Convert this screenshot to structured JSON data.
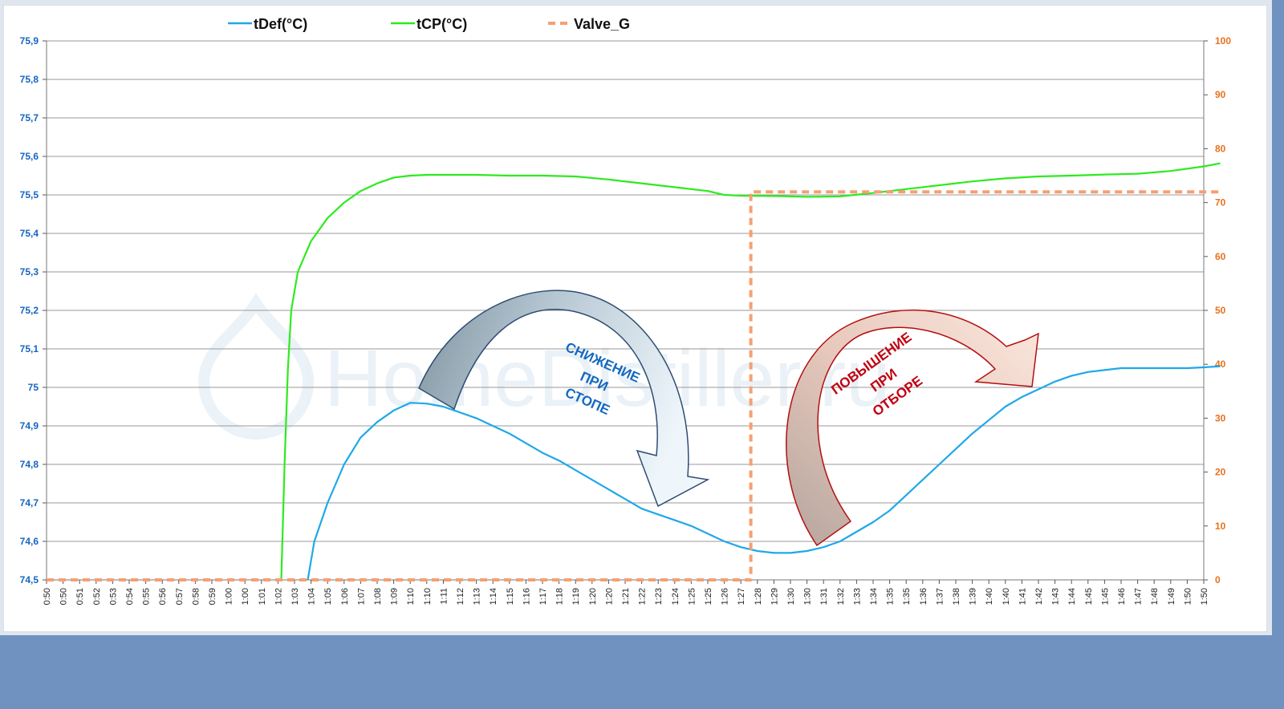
{
  "chart_data": {
    "type": "line",
    "legend_position": "top",
    "grid": true,
    "x_ticks": [
      "0:50",
      "0:50",
      "0:51",
      "0:52",
      "0:53",
      "0:54",
      "0:55",
      "0:56",
      "0:57",
      "0:58",
      "0:59",
      "1:00",
      "1:00",
      "1:01",
      "1:02",
      "1:03",
      "1:04",
      "1:05",
      "1:06",
      "1:07",
      "1:08",
      "1:09",
      "1:10",
      "1:10",
      "1:11",
      "1:12",
      "1:13",
      "1:14",
      "1:15",
      "1:16",
      "1:17",
      "1:18",
      "1:19",
      "1:20",
      "1:20",
      "1:21",
      "1:22",
      "1:23",
      "1:24",
      "1:25",
      "1:25",
      "1:26",
      "1:27",
      "1:28",
      "1:29",
      "1:30",
      "1:30",
      "1:31",
      "1:32",
      "1:33",
      "1:34",
      "1:35",
      "1:35",
      "1:36",
      "1:37",
      "1:38",
      "1:39",
      "1:40",
      "1:40",
      "1:41",
      "1:42",
      "1:43",
      "1:44",
      "1:45",
      "1:45",
      "1:46",
      "1:47",
      "1:48",
      "1:49",
      "1:50",
      "1:50"
    ],
    "y_left": {
      "min": 74.5,
      "max": 75.9,
      "step": 0.1,
      "tick_labels": [
        "74,5",
        "74,6",
        "74,7",
        "74,8",
        "74,9",
        "75",
        "75,1",
        "75,2",
        "75,3",
        "75,4",
        "75,5",
        "75,6",
        "75,7",
        "75,8",
        "75,9"
      ]
    },
    "y_right": {
      "min": 0,
      "max": 100,
      "step": 10,
      "tick_labels": [
        "0",
        "10",
        "20",
        "30",
        "40",
        "50",
        "60",
        "70",
        "80",
        "90",
        "100"
      ]
    },
    "series": [
      {
        "name": "tDef(°C)",
        "axis": "left",
        "color": "#1fa8e8",
        "dash": false,
        "points": [
          [
            15.8,
            74.5
          ],
          [
            16.2,
            74.6
          ],
          [
            17,
            74.7
          ],
          [
            18,
            74.8
          ],
          [
            19,
            74.87
          ],
          [
            20,
            74.91
          ],
          [
            21,
            74.94
          ],
          [
            22,
            74.96
          ],
          [
            23,
            74.958
          ],
          [
            24,
            74.95
          ],
          [
            25,
            74.935
          ],
          [
            26,
            74.92
          ],
          [
            27,
            74.9
          ],
          [
            28,
            74.88
          ],
          [
            29,
            74.855
          ],
          [
            30,
            74.83
          ],
          [
            31,
            74.81
          ],
          [
            32,
            74.785
          ],
          [
            33,
            74.76
          ],
          [
            34,
            74.735
          ],
          [
            35,
            74.71
          ],
          [
            36,
            74.685
          ],
          [
            37,
            74.67
          ],
          [
            38,
            74.655
          ],
          [
            39,
            74.64
          ],
          [
            40,
            74.62
          ],
          [
            41,
            74.6
          ],
          [
            42,
            74.585
          ],
          [
            43,
            74.575
          ],
          [
            44,
            74.57
          ],
          [
            45,
            74.57
          ],
          [
            46,
            74.575
          ],
          [
            47,
            74.585
          ],
          [
            48,
            74.6
          ],
          [
            49,
            74.625
          ],
          [
            50,
            74.65
          ],
          [
            51,
            74.68
          ],
          [
            52,
            74.72
          ],
          [
            53,
            74.76
          ],
          [
            54,
            74.8
          ],
          [
            55,
            74.84
          ],
          [
            56,
            74.88
          ],
          [
            57,
            74.915
          ],
          [
            58,
            74.95
          ],
          [
            59,
            74.975
          ],
          [
            60,
            74.995
          ],
          [
            61,
            75.015
          ],
          [
            62,
            75.03
          ],
          [
            63,
            75.04
          ],
          [
            64,
            75.045
          ],
          [
            65,
            75.05
          ],
          [
            66,
            75.05
          ],
          [
            67,
            75.05
          ],
          [
            68,
            75.05
          ],
          [
            69,
            75.05
          ],
          [
            70,
            75.052
          ],
          [
            71,
            75.055
          ]
        ]
      },
      {
        "name": "tCP(°C)",
        "axis": "left",
        "color": "#2eea1f",
        "dash": false,
        "points": [
          [
            14.2,
            74.5
          ],
          [
            14.4,
            74.8
          ],
          [
            14.6,
            75.05
          ],
          [
            14.8,
            75.2
          ],
          [
            15.2,
            75.3
          ],
          [
            16,
            75.38
          ],
          [
            17,
            75.44
          ],
          [
            18,
            75.48
          ],
          [
            19,
            75.51
          ],
          [
            20,
            75.53
          ],
          [
            21,
            75.545
          ],
          [
            22,
            75.55
          ],
          [
            23,
            75.552
          ],
          [
            24,
            75.552
          ],
          [
            26,
            75.552
          ],
          [
            28,
            75.55
          ],
          [
            30,
            75.55
          ],
          [
            32,
            75.548
          ],
          [
            34,
            75.54
          ],
          [
            36,
            75.53
          ],
          [
            38,
            75.52
          ],
          [
            40,
            75.51
          ],
          [
            41,
            75.5
          ],
          [
            42,
            75.498
          ],
          [
            44,
            75.497
          ],
          [
            46,
            75.495
          ],
          [
            48,
            75.496
          ],
          [
            50,
            75.505
          ],
          [
            52,
            75.515
          ],
          [
            54,
            75.525
          ],
          [
            56,
            75.535
          ],
          [
            58,
            75.543
          ],
          [
            60,
            75.548
          ],
          [
            62,
            75.55
          ],
          [
            64,
            75.553
          ],
          [
            66,
            75.555
          ],
          [
            68,
            75.562
          ],
          [
            70,
            75.574
          ],
          [
            71,
            75.582
          ]
        ]
      },
      {
        "name": "Valve_G",
        "axis": "right",
        "color": "#f5a072",
        "dash": true,
        "points": [
          [
            0,
            0
          ],
          [
            42.6,
            0
          ],
          [
            42.6,
            72
          ],
          [
            71,
            72
          ]
        ]
      }
    ],
    "annotations": [
      {
        "text_lines": [
          "СНИЖЕНИЕ",
          "ПРИ",
          "СТОПЕ"
        ],
        "color": "#1569c0"
      },
      {
        "text_lines": [
          "ПОВЫШЕНИЕ",
          "ПРИ",
          "ОТБОРЕ"
        ],
        "color": "#c00010"
      }
    ],
    "watermark": "HomeDistiller.ru"
  }
}
